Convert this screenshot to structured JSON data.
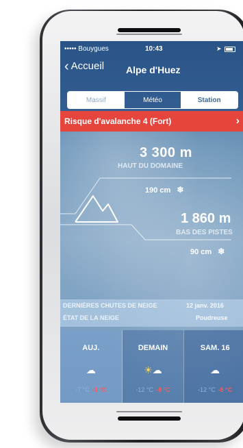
{
  "status": {
    "carrier": "••••• Bouygues",
    "time": "10:43"
  },
  "nav": {
    "back_label": "Accueil",
    "title": "Alpe d'Huez"
  },
  "tabs": [
    "Massif",
    "Météo",
    "Station"
  ],
  "alert": {
    "text": "Risque d'avalanche 4 (Fort)",
    "color": "#e6453d"
  },
  "altitudes": {
    "high": {
      "value": "3 300 m",
      "label": "HAUT DU DOMAINE",
      "snow": "190 cm"
    },
    "low": {
      "value": "1 860 m",
      "label": "BAS DES PISTES",
      "snow": "90 cm"
    }
  },
  "info": {
    "last_snow_label": "DERNIÈRES CHUTES DE NEIGE",
    "last_snow_value": "12 janv. 2016",
    "snow_state_label": "ÉTAT DE LA NEIGE",
    "snow_state_value": "Poudreuse"
  },
  "forecast": [
    {
      "day": "AUJ.",
      "icon": "snow-cloud-icon",
      "min": "-7 °C",
      "max": "-1 °C"
    },
    {
      "day": "DEMAIN",
      "icon": "sun-cloud-icon",
      "min": "-12 °C",
      "max": "-8 °C"
    },
    {
      "day": "SAM. 16",
      "icon": "snow-cloud-icon",
      "min": "-12 °C",
      "max": "-8 °C"
    }
  ]
}
